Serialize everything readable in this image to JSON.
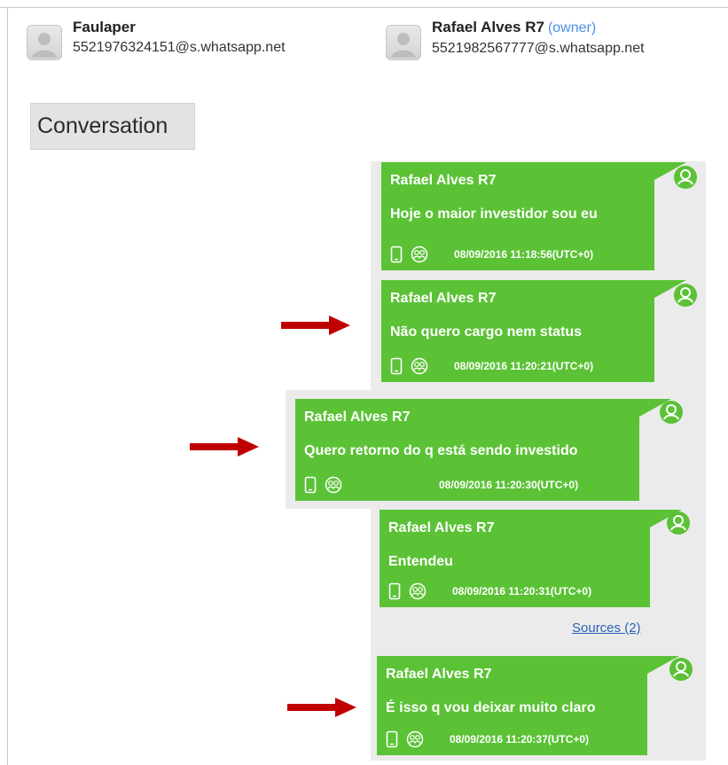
{
  "participants": [
    {
      "name": "Faulaper",
      "jid": "5521976324151@s.whatsapp.net",
      "owner_label": ""
    },
    {
      "name": "Rafael Alves R7",
      "jid": "5521982567777@s.whatsapp.net",
      "owner_label": "(owner)"
    }
  ],
  "conversation": {
    "title": "Conversation",
    "messages": [
      {
        "sender": "Rafael Alves R7",
        "text": "Hoje o maior investidor sou eu",
        "timestamp": "08/09/2016 11:18:56(UTC+0)",
        "marked": false
      },
      {
        "sender": "Rafael Alves R7",
        "text": "Não quero cargo nem status",
        "timestamp": "08/09/2016 11:20:21(UTC+0)",
        "marked": true
      },
      {
        "sender": "Rafael Alves R7",
        "text": "Quero retorno do q está sendo investido",
        "timestamp": "08/09/2016 11:20:30(UTC+0)",
        "marked": true
      },
      {
        "sender": "Rafael Alves R7",
        "text": "Entendeu",
        "timestamp": "08/09/2016 11:20:31(UTC+0)",
        "marked": false
      },
      {
        "sender": "Rafael Alves R7",
        "text": "É isso q vou deixar muito claro",
        "timestamp": "08/09/2016 11:20:37(UTC+0)",
        "marked": true
      }
    ],
    "sources_link": "Sources (2)"
  },
  "colors": {
    "bubble": "#5bc236",
    "arrow": "#c00000",
    "owner": "#4a90e2",
    "link": "#2a62b8"
  },
  "icons": [
    "avatar-placeholder-icon",
    "phone-icon",
    "group-icon",
    "user-circle-icon",
    "right-arrow-icon"
  ]
}
